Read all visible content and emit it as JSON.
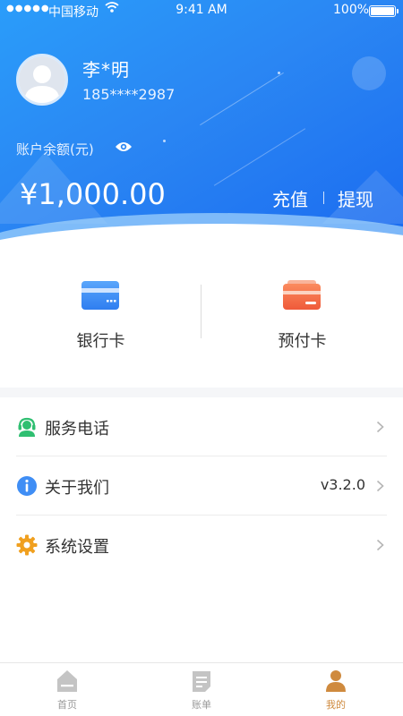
{
  "status_bar": {
    "signal": "●●●●●",
    "carrier": "中国移动",
    "time": "9:41 AM",
    "battery": "100%"
  },
  "profile": {
    "name": "李*明",
    "phone": "185****2987"
  },
  "balance": {
    "label": "账户余额(元)",
    "amount": "¥1,000.00",
    "recharge": "充值",
    "withdraw": "提现"
  },
  "cards": [
    {
      "label": "银行卡",
      "icon": "bank-card-icon",
      "color": "#3f8ef5"
    },
    {
      "label": "预付卡",
      "icon": "prepaid-card-icon",
      "color": "#f46a45"
    }
  ],
  "menu": [
    {
      "label": "服务电话",
      "icon": "customer-service-icon",
      "value": ""
    },
    {
      "label": "关于我们",
      "icon": "info-icon",
      "value": "v3.2.0"
    },
    {
      "label": "系统设置",
      "icon": "gear-icon",
      "value": ""
    }
  ],
  "tabs": [
    {
      "label": "首页",
      "icon": "home-icon",
      "active": false
    },
    {
      "label": "账单",
      "icon": "bill-icon",
      "active": false
    },
    {
      "label": "我的",
      "icon": "profile-icon",
      "active": true
    }
  ],
  "colors": {
    "header_blue": "#2a86f3",
    "active_tab": "#cf8a3e",
    "inactive_tab": "#999999"
  }
}
